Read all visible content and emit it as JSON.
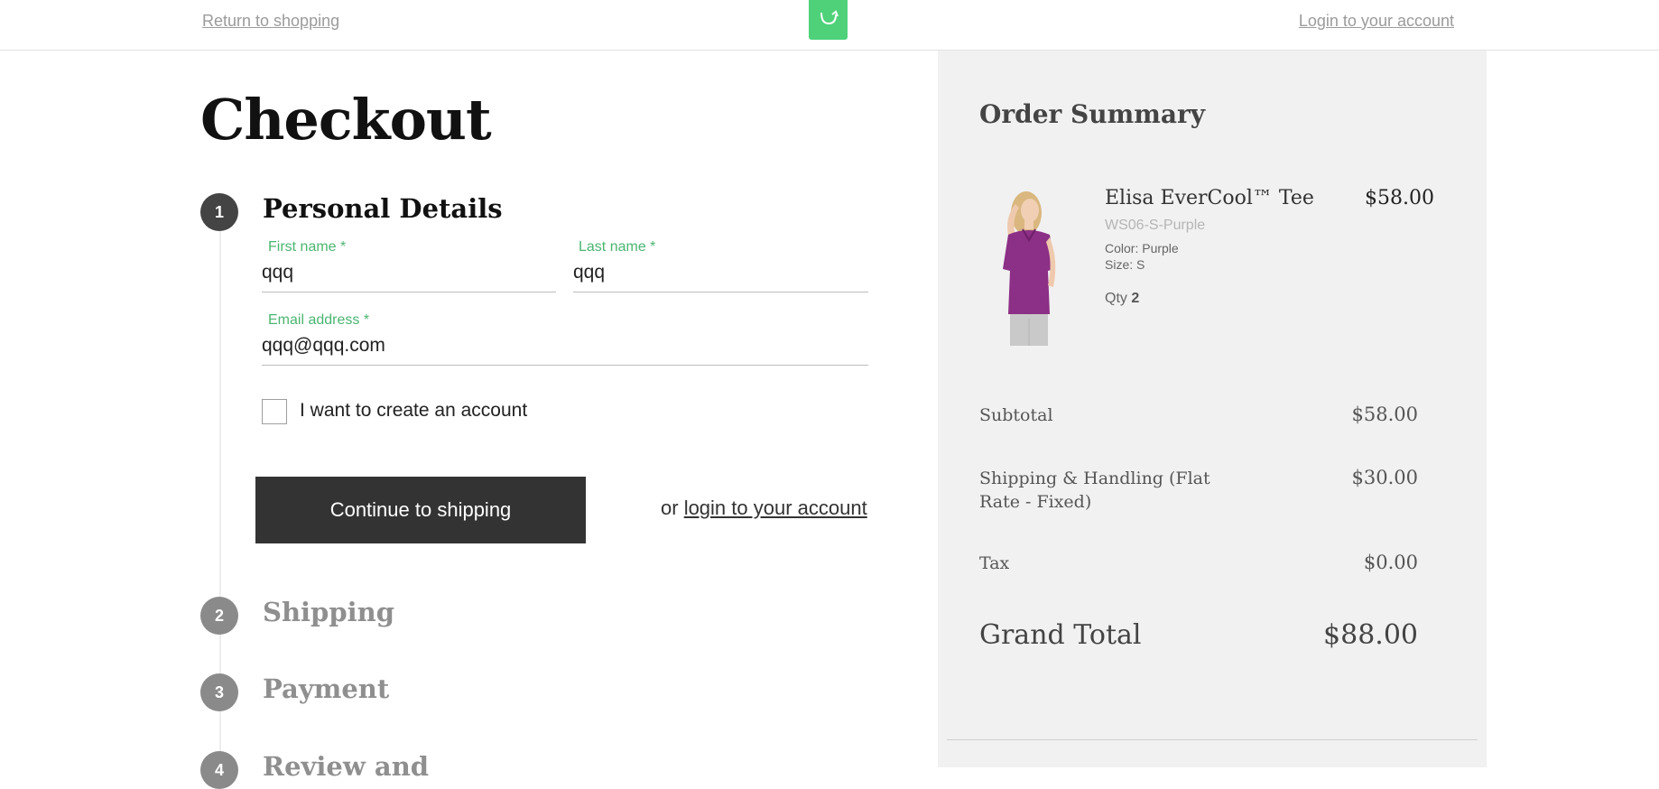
{
  "header": {
    "return_link": "Return to shopping",
    "login_link": "Login to your account",
    "logo_icon": "shopping-bag-icon",
    "brand_color": "#4fd17a"
  },
  "checkout": {
    "title": "Checkout",
    "steps": [
      {
        "number": "1",
        "title": "Personal Details",
        "active": true
      },
      {
        "number": "2",
        "title": "Shipping",
        "active": false
      },
      {
        "number": "3",
        "title": "Payment",
        "active": false
      },
      {
        "number": "4",
        "title": "Review and",
        "active": false
      }
    ],
    "form": {
      "first_name": {
        "label": "First name *",
        "value": "qqq"
      },
      "last_name": {
        "label": "Last name *",
        "value": "qqq"
      },
      "email": {
        "label": "Email address *",
        "value": "qqq@qqq.com"
      },
      "create_account": {
        "label": "I want to create an account",
        "checked": false
      }
    },
    "continue_button": "Continue to shipping",
    "or_text": "or",
    "login_link": "login to your account",
    "label_color": "#4bb571",
    "button_color": "#333333"
  },
  "summary": {
    "title": "Order Summary",
    "item": {
      "name": "Elisa EverCool™ Tee",
      "sku": "WS06-S-Purple",
      "color": "Color: Purple",
      "size": "Size: S",
      "qty_label": "Qty",
      "qty": "2",
      "price": "$58.00"
    },
    "totals": {
      "subtotal_label": "Subtotal",
      "subtotal": "$58.00",
      "shipping_label": "Shipping & Handling (Flat Rate - Fixed)",
      "shipping": "$30.00",
      "tax_label": "Tax",
      "tax": "$0.00",
      "grand_total_label": "Grand Total",
      "grand_total": "$88.00"
    },
    "background_color": "#f1f1f1"
  }
}
